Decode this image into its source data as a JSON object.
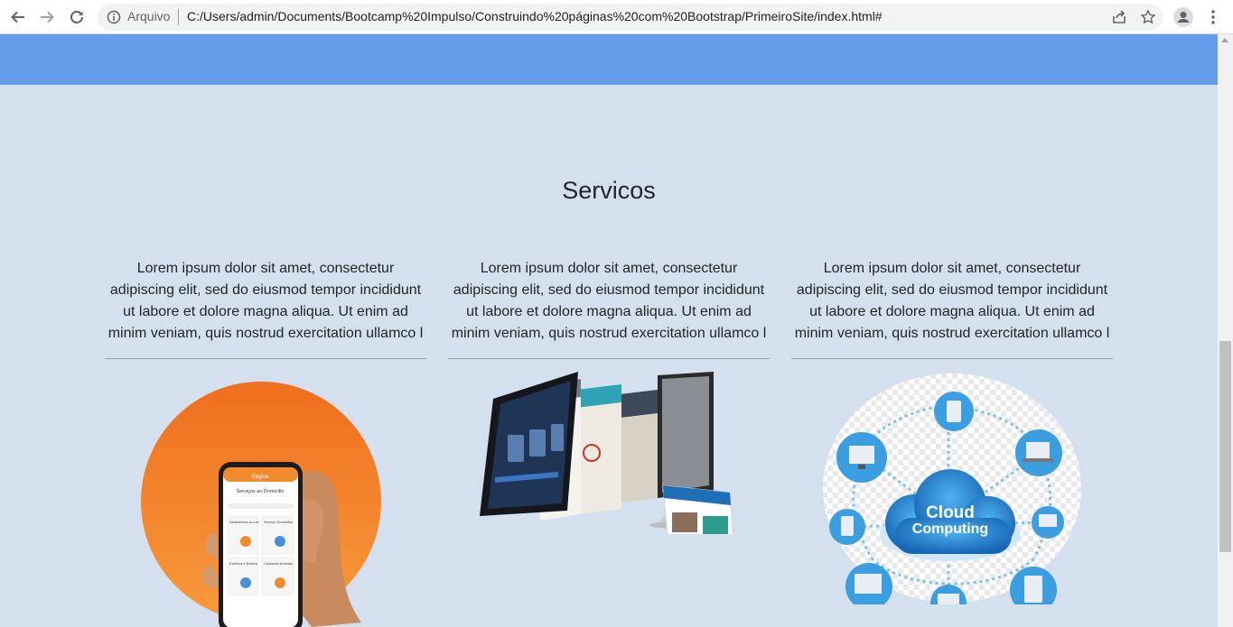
{
  "browser": {
    "security_label": "Arquivo",
    "url": "C:/Users/admin/Documents/Bootcamp%20Impulso/Construindo%20páginas%20com%20Bootstrap/PrimeiroSite/index.html#"
  },
  "services": {
    "title": "Servicos",
    "items": [
      {
        "text": "Lorem ipsum dolor sit amet, consectetur adipiscing elit, sed do eiusmod tempor incididunt ut labore et dolore magna aliqua. Ut enim ad minim veniam, quis nostrud exercitation ullamco l",
        "image": "mobile-app-phone"
      },
      {
        "text": "Lorem ipsum dolor sit amet, consectetur adipiscing elit, sed do eiusmod tempor incididunt ut labore et dolore magna aliqua. Ut enim ad minim veniam, quis nostrud exercitation ullamco l",
        "image": "responsive-web-design-screens"
      },
      {
        "text": "Lorem ipsum dolor sit amet, consectetur adipiscing elit, sed do eiusmod tempor incididunt ut labore et dolore magna aliqua. Ut enim ad minim veniam, quis nostrud exercitation ullamco l",
        "image": "cloud-computing-network"
      }
    ],
    "phone_screen": {
      "brand": "Página",
      "heading": "Serviços ao Domicílio",
      "tiles": [
        "Assistência ao Lar",
        "Serviço Domiciliar",
        "Estética e Beleza",
        "Cuidados Animais"
      ]
    },
    "cloud_label_1": "Cloud",
    "cloud_label_2": "Computing"
  },
  "colors": {
    "topbar": "#659deb",
    "page_background": "#d5e0ee",
    "orange": "#f28a2e",
    "cloud_blue": "#1e7fd0"
  }
}
